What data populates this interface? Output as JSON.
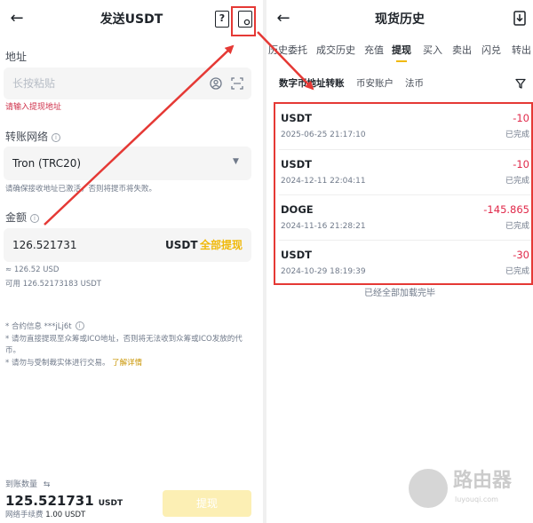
{
  "send": {
    "title": "发送USDT",
    "back_icon": "←",
    "address_label": "地址",
    "address_placeholder": "长按粘贴",
    "address_error": "请输入提现地址",
    "network_label": "转账网络",
    "network_value": "Tron (TRC20)",
    "network_hint": "请确保接收地址已激活，否则将提币将失败。",
    "amount_label": "金额",
    "amount_value": "126.521731",
    "amount_unit": "USDT",
    "withdraw_all": "全部提现",
    "amount_approx": "≈ 126.52 USD",
    "available": "可用 126.52173183 USDT",
    "notes": [
      "* 合约信息 ***jLj6t",
      "* 请勿直接提现至众筹或ICO地址，否则将无法收到众筹或ICO发放的代币。",
      "* 请勿与受制裁实体进行交易。"
    ],
    "learn_more": "了解详情",
    "receive_label": "到账数量",
    "receive_amount": "125.521731",
    "receive_unit": "USDT",
    "fee_label": "网络手续费",
    "fee_value": "1.00 USDT",
    "withdraw_button": "提现"
  },
  "history": {
    "title": "现货历史",
    "back_icon": "←",
    "tabs": [
      "历史委托",
      "成交历史",
      "充值",
      "提现",
      "买入",
      "卖出",
      "闪兑",
      "转出"
    ],
    "active_tab": "提现",
    "subtabs": [
      "数字币地址转账",
      "币安账户",
      "法币"
    ],
    "records": [
      {
        "coin": "USDT",
        "time": "2025-06-25 21:17:10",
        "amount": "-10",
        "status": "已完成"
      },
      {
        "coin": "USDT",
        "time": "2024-12-11 22:04:11",
        "amount": "-10",
        "status": "已完成"
      },
      {
        "coin": "DOGE",
        "time": "2024-11-16 21:28:21",
        "amount": "-145.865",
        "status": "已完成"
      },
      {
        "coin": "USDT",
        "time": "2024-10-29 18:19:39",
        "amount": "-30",
        "status": "已完成"
      }
    ],
    "all_loaded": "已经全部加载完毕"
  },
  "watermark": {
    "text": "路由器",
    "sub": "luyouqi.com"
  },
  "colors": {
    "accent": "#f0b90b",
    "negative": "#e0294a",
    "annotation": "#e53935"
  }
}
